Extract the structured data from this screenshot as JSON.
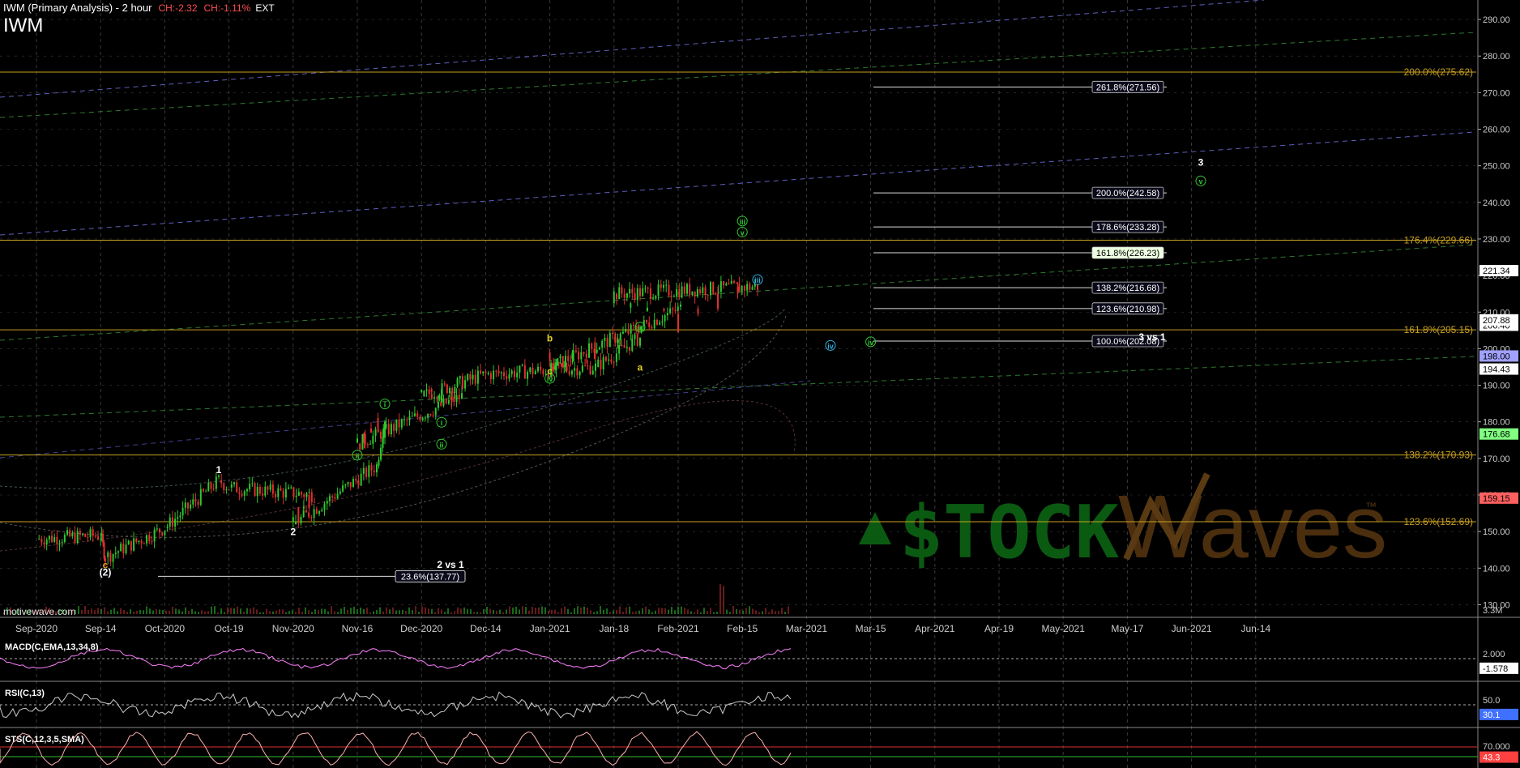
{
  "header": {
    "title": "IWM (Primary Analysis) - 2 hour",
    "ch_price": "CH:-2.32",
    "ch_pct": "CH:-1.11%",
    "ext": "EXT",
    "symbol": "IWM"
  },
  "source_label": "motivewave.com",
  "colors": {
    "background": "#000000",
    "grid": "#3a3a3a",
    "fib_lines": "#c8a020",
    "up_candle": "#2ec82e",
    "down_candle": "#e03030",
    "trend_green": "#2e7a2e",
    "trend_blue": "#6060c0",
    "wave_green": "#30c830",
    "wave_cyan": "#30b0e0",
    "wave_orange": "#e0a020",
    "macd": "#ff80ff",
    "macd_hist": "#40a0e0",
    "stoch_k": "#ffb0b0"
  },
  "chart_data": {
    "type": "candlestick",
    "title": "IWM (Primary Analysis) - 2 hour",
    "x_axis_labels": [
      "Sep-2020",
      "Sep-14",
      "Oct-2020",
      "Oct-19",
      "Nov-2020",
      "Nov-16",
      "Dec-2020",
      "Dec-14",
      "Jan-2021",
      "Jan-18",
      "Feb-2021",
      "Feb-15",
      "Mar-2021",
      "Mar-15",
      "Apr-2021",
      "Apr-19",
      "May-2021",
      "May-17",
      "Jun-2021",
      "Jun-14"
    ],
    "y_axis_ticks": [
      130,
      140,
      150,
      160,
      170,
      180,
      190,
      200,
      210,
      220,
      230,
      240,
      250,
      260,
      270,
      280,
      290
    ],
    "ylim": [
      127,
      294
    ],
    "price_path": [
      {
        "x": "Sep-2020",
        "y": 148
      },
      {
        "x": "Sep-14",
        "y": 149
      },
      {
        "x": "Sep-23",
        "y": 143
      },
      {
        "x": "Oct-2020",
        "y": 151
      },
      {
        "x": "Oct-12",
        "y": 164
      },
      {
        "x": "Oct-19",
        "y": 162
      },
      {
        "x": "Oct-26",
        "y": 160
      },
      {
        "x": "Nov-2020",
        "y": 152
      },
      {
        "x": "Nov-09",
        "y": 168
      },
      {
        "x": "Nov-10",
        "y": 181
      },
      {
        "x": "Nov-16",
        "y": 174
      },
      {
        "x": "Nov-25",
        "y": 187
      },
      {
        "x": "Dec-2020",
        "y": 187
      },
      {
        "x": "Dec-14",
        "y": 193
      },
      {
        "x": "Dec-21",
        "y": 195
      },
      {
        "x": "Dec-28",
        "y": 203
      },
      {
        "x": "Jan-2021",
        "y": 195
      },
      {
        "x": "Jan-08",
        "y": 211
      },
      {
        "x": "Jan-18",
        "y": 215
      },
      {
        "x": "Jan-25",
        "y": 217
      },
      {
        "x": "Feb-2021",
        "y": 206
      }
    ],
    "price_labels": [
      {
        "value": "221.34",
        "color": "#ffffff",
        "text": "#000000"
      },
      {
        "value": "206.40",
        "color": "#ffffff",
        "text": "#000000"
      },
      {
        "value": "207.88",
        "color": "#ffffff",
        "text": "#000000"
      },
      {
        "value": "198.00",
        "color": "#a0a0ff",
        "text": "#000000"
      },
      {
        "value": "194.43",
        "color": "#ffffff",
        "text": "#000000"
      },
      {
        "value": "176.68",
        "color": "#80ff80",
        "text": "#000000"
      },
      {
        "value": "159.15",
        "color": "#ff6060",
        "text": "#000000"
      }
    ],
    "volume_label": "3.3M",
    "fib_levels_left": [
      {
        "label": "200.0%(275.62)",
        "value": 275.62
      },
      {
        "label": "176.4%(229.66)",
        "value": 229.66
      },
      {
        "label": "161.8%(205.15)",
        "value": 205.15
      },
      {
        "label": "138.2%(170.93)",
        "value": 170.93
      },
      {
        "label": "123.6%(152.69)",
        "value": 152.69
      }
    ],
    "fib_levels_right": [
      {
        "label": "261.8%(271.56)",
        "value": 271.56,
        "highlight": false
      },
      {
        "label": "200.0%(242.58)",
        "value": 242.58,
        "highlight": false
      },
      {
        "label": "178.6%(233.28)",
        "value": 233.28,
        "highlight": false
      },
      {
        "label": "161.8%(226.23)",
        "value": 226.23,
        "highlight": true
      },
      {
        "label": "138.2%(216.68)",
        "value": 216.68,
        "highlight": false
      },
      {
        "label": "123.6%(210.98)",
        "value": 210.98,
        "highlight": false
      },
      {
        "label": "100.0%(202.08)",
        "value": 202.08,
        "highlight": false
      }
    ],
    "fib_bottom": {
      "label": "23.6%(137.77)",
      "value": 137.77
    },
    "notes": [
      "2 vs 1",
      "3 vs 1"
    ],
    "wave_labels": [
      {
        "text": "1",
        "x": "Oct-12",
        "y": 166,
        "color": "#ffffff"
      },
      {
        "text": "2",
        "x": "Nov-2020",
        "y": 149,
        "color": "#ffffff"
      },
      {
        "text": "c",
        "x": "Sep-23",
        "y": 140,
        "color": "#e0a020"
      },
      {
        "text": "(2)",
        "x": "Sep-23",
        "y": 138,
        "color": "#ffffff"
      },
      {
        "text": "i",
        "x": "Nov-10",
        "y": 184,
        "color": "#30c830"
      },
      {
        "text": "ii",
        "x": "Nov-16",
        "y": 170,
        "color": "#30c830"
      },
      {
        "text": "i",
        "x": "Nov-20",
        "y": 179,
        "color": "#30c830"
      },
      {
        "text": "ii",
        "x": "Nov-20",
        "y": 173,
        "color": "#30c830"
      },
      {
        "text": "iii",
        "x": "Dec-28",
        "y": 205,
        "color": "#30c830"
      },
      {
        "text": "iv",
        "x": "Jan-2021",
        "y": 191,
        "color": "#30c830"
      },
      {
        "text": "a",
        "x": "Dec-28",
        "y": 194,
        "color": "#e0d020"
      },
      {
        "text": "b",
        "x": "Jan-2021",
        "y": 202,
        "color": "#e0d020"
      },
      {
        "text": "c",
        "x": "Jan-2021",
        "y": 193,
        "color": "#e0d020"
      },
      {
        "text": "iii",
        "x": "Jan-25",
        "y": 218,
        "color": "#30b0e0"
      },
      {
        "text": "iv",
        "x": "Feb-10",
        "y": 200,
        "color": "#30b0e0"
      },
      {
        "text": "iii",
        "x": "Feb-15",
        "y": 234,
        "color": "#30c830"
      },
      {
        "text": "v",
        "x": "Feb-15",
        "y": 231,
        "color": "#30c830"
      },
      {
        "text": "iv",
        "x": "Mar-15",
        "y": 201,
        "color": "#30c830"
      },
      {
        "text": "3",
        "x": "Apr-26",
        "y": 250,
        "color": "#ffffff"
      },
      {
        "text": "v",
        "x": "Apr-26",
        "y": 245,
        "color": "#30c830"
      }
    ]
  },
  "indicators": [
    {
      "name": "MACD(C,EMA,13,34,8)",
      "ticks": [
        "2.000"
      ],
      "value": "-1.578",
      "value_bg": "#ffffff"
    },
    {
      "name": "RSI(C,13)",
      "ticks": [
        "50.0"
      ],
      "value": "30.1",
      "value_bg": "#4070ff"
    },
    {
      "name": "STS(C,12,3,5,SMA)",
      "ticks": [
        "70.000"
      ],
      "value": "43.3",
      "value_bg": "#ff4040"
    }
  ],
  "watermark": {
    "stock": "$TOCK",
    "waves": "Waves",
    "tm": "™"
  }
}
